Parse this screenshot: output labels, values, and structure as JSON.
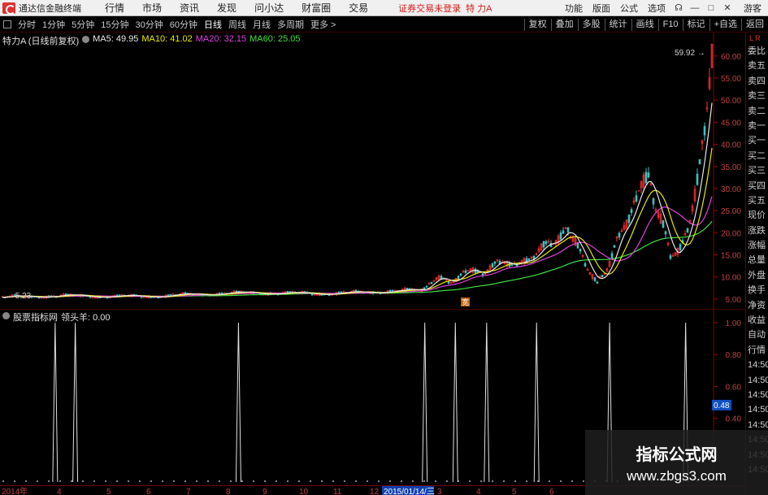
{
  "app": {
    "title": "通达信金融终端",
    "login_status": "证券交易未登录",
    "stock_title": "特 力A",
    "guest": "游客"
  },
  "menu": [
    "行情",
    "市场",
    "资讯",
    "发现",
    "问小达",
    "财富圈",
    "交易"
  ],
  "menu_right": [
    "功能",
    "版面",
    "公式",
    "选项"
  ],
  "toolbar": {
    "periods": [
      "分时",
      "1分钟",
      "5分钟",
      "15分钟",
      "30分钟",
      "60分钟",
      "日线",
      "周线",
      "月线",
      "多周期"
    ],
    "active": "日线",
    "more": "更多 >",
    "right_buttons": [
      "复权",
      "叠加",
      "多股",
      "统计",
      "画线",
      "F10",
      "标记",
      "+自选",
      "返回"
    ]
  },
  "main_chart": {
    "title": "特力A (日线前复权)",
    "ma5": "MA5: 49.95",
    "ma10": "MA10: 41.02",
    "ma20": "MA20: 32.15",
    "ma60": "MA60: 25.05",
    "low_label": "5.23",
    "high_label": "59.92",
    "marker_label": "宽",
    "y_axis": [
      "60.00",
      "55.00",
      "50.00",
      "45.00",
      "40.00",
      "35.00",
      "30.00",
      "25.00",
      "20.00",
      "15.00",
      "10.00",
      "5.00"
    ],
    "y_min": 3.5,
    "y_max": 62,
    "colors": {
      "ma5": "#e8e8e8",
      "ma10": "#e8e800",
      "ma20": "#e040e0",
      "ma60": "#40e040",
      "up": "#ff3030",
      "down": "#40c0c0"
    }
  },
  "indicator": {
    "title": "股票指标网",
    "name_value": "领头羊: 0.00",
    "y_axis": [
      "1.00",
      "0.80",
      "0.60",
      "0.40"
    ],
    "current_label": "0.48",
    "spike_positions": [
      0.074,
      0.101,
      0.32,
      0.57,
      0.611,
      0.653,
      0.72,
      0.818,
      0.92
    ]
  },
  "date_axis": {
    "year_label": "2014年",
    "labels": [
      "4",
      "5",
      "6",
      "7",
      "8",
      "9",
      "10",
      "11",
      "12"
    ],
    "highlight": "2015/01/14/三",
    "after": [
      "3",
      "4",
      "5",
      "6"
    ]
  },
  "quote_panel": [
    "委比",
    "卖五",
    "卖四",
    "卖三",
    "卖二",
    "卖一",
    "买一",
    "买二",
    "买三",
    "买四",
    "买五",
    "现价",
    "涨跌",
    "涨幅",
    "总量",
    "外盘",
    "换手",
    "净资",
    "收益",
    "自动",
    "行情",
    "14:50",
    "14:50",
    "14:50",
    "14:50",
    "14:50",
    "14:50",
    "14:50",
    "14:50"
  ],
  "watermark": {
    "title": "指标公式网",
    "url": "www.zbgs3.com"
  }
}
